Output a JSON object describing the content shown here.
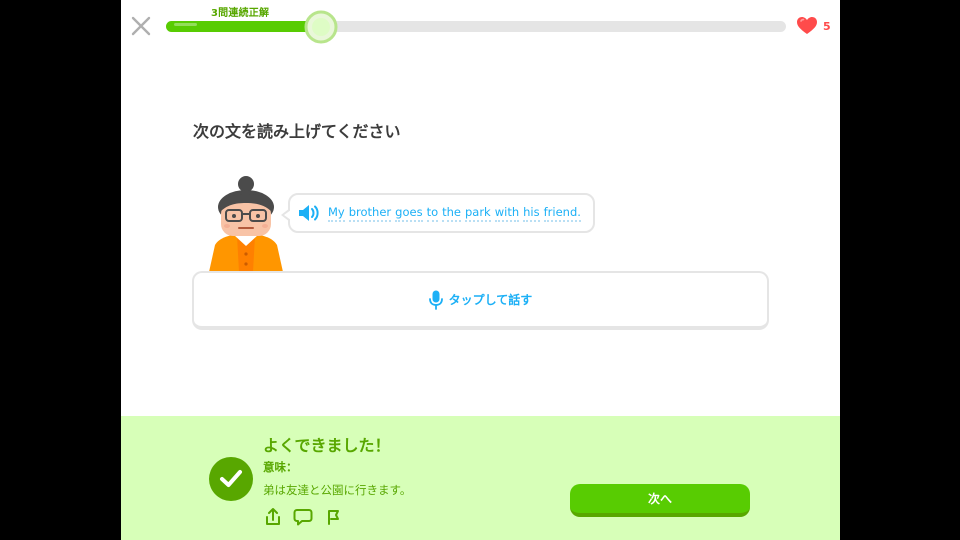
{
  "header": {
    "streak_label": "3問連続正解",
    "progress": 0.25,
    "hearts": "5",
    "icons": {
      "close": "close-icon",
      "heart": "heart-icon"
    }
  },
  "prompt": {
    "title": "次の文を読み上げてください",
    "sentence_words": [
      "My",
      "brother",
      "goes",
      "to",
      "the",
      "park",
      "with",
      "his",
      "friend."
    ],
    "speaker_icon": "speaker-icon"
  },
  "tap_to_speak": {
    "label": "タップして話す",
    "icon": "microphone-icon"
  },
  "feedback": {
    "title": "よくできました！",
    "meaning_label": "意味：",
    "meaning": "弟は友達と公園に行きます。",
    "next_label": "次へ",
    "icons": [
      "share-icon",
      "comment-icon",
      "report-flag-icon"
    ]
  },
  "colors": {
    "accent_green": "#58cc02",
    "dark_green": "#58a700",
    "footer_bg": "#d7ffb8",
    "blue": "#1cb0f6",
    "heart_red": "#ff4b4b"
  }
}
